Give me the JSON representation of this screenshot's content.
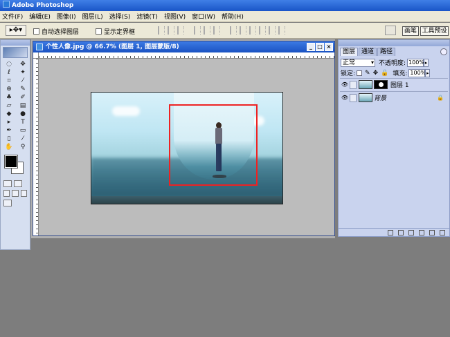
{
  "app": {
    "title": "Adobe Photoshop"
  },
  "menu": [
    "文件(F)",
    "编辑(E)",
    "图像(I)",
    "图层(L)",
    "选择(S)",
    "滤镜(T)",
    "视图(V)",
    "窗口(W)",
    "帮助(H)"
  ],
  "options_bar": {
    "tool_icon": "move-tool-icon",
    "auto_select_label": "自动选择图层",
    "show_bounds_label": "显示定界框",
    "brushes_tab": "画笔",
    "tool_presets_tab": "工具预设"
  },
  "document": {
    "title": "个性人像.jpg @ 66.7% (图层 1, 图层蒙版/8)",
    "minimize_label": "_",
    "maximize_label": "□",
    "close_label": "×"
  },
  "tools": [
    {
      "name": "marquee-tool",
      "glyph": "◌"
    },
    {
      "name": "move-tool",
      "glyph": "✥"
    },
    {
      "name": "lasso-tool",
      "glyph": "ℓ"
    },
    {
      "name": "magic-wand-tool",
      "glyph": "✦"
    },
    {
      "name": "crop-tool",
      "glyph": "⌗"
    },
    {
      "name": "slice-tool",
      "glyph": "⁄"
    },
    {
      "name": "healing-brush-tool",
      "glyph": "⊕"
    },
    {
      "name": "brush-tool",
      "glyph": "✎"
    },
    {
      "name": "clone-stamp-tool",
      "glyph": "♣"
    },
    {
      "name": "history-brush-tool",
      "glyph": "✐"
    },
    {
      "name": "eraser-tool",
      "glyph": "▱"
    },
    {
      "name": "gradient-tool",
      "glyph": "▤"
    },
    {
      "name": "blur-tool",
      "glyph": "◆"
    },
    {
      "name": "dodge-tool",
      "glyph": "●"
    },
    {
      "name": "path-selection-tool",
      "glyph": "▸"
    },
    {
      "name": "type-tool",
      "glyph": "T"
    },
    {
      "name": "pen-tool",
      "glyph": "✒"
    },
    {
      "name": "shape-tool",
      "glyph": "▭"
    },
    {
      "name": "notes-tool",
      "glyph": "▯"
    },
    {
      "name": "eyedropper-tool",
      "glyph": "⁄"
    },
    {
      "name": "hand-tool",
      "glyph": "✋"
    },
    {
      "name": "zoom-tool",
      "glyph": "⚲"
    }
  ],
  "layers_panel": {
    "tabs": [
      "图层",
      "通道",
      "路径"
    ],
    "blend_mode": "正常",
    "opacity_label": "不透明度:",
    "opacity_value": "100%",
    "lock_label": "锁定:",
    "fill_label": "填充:",
    "fill_value": "100%",
    "layers": [
      {
        "name": "图层 1",
        "selected": true,
        "has_mask": true,
        "visible": true
      },
      {
        "name": "背景",
        "selected": false,
        "has_mask": false,
        "visible": true,
        "locked": true
      }
    ]
  },
  "colors": {
    "selection_rect": "#e22222",
    "title_bar": "#1a55c8",
    "foreground": "#000000",
    "background": "#ffffff"
  }
}
